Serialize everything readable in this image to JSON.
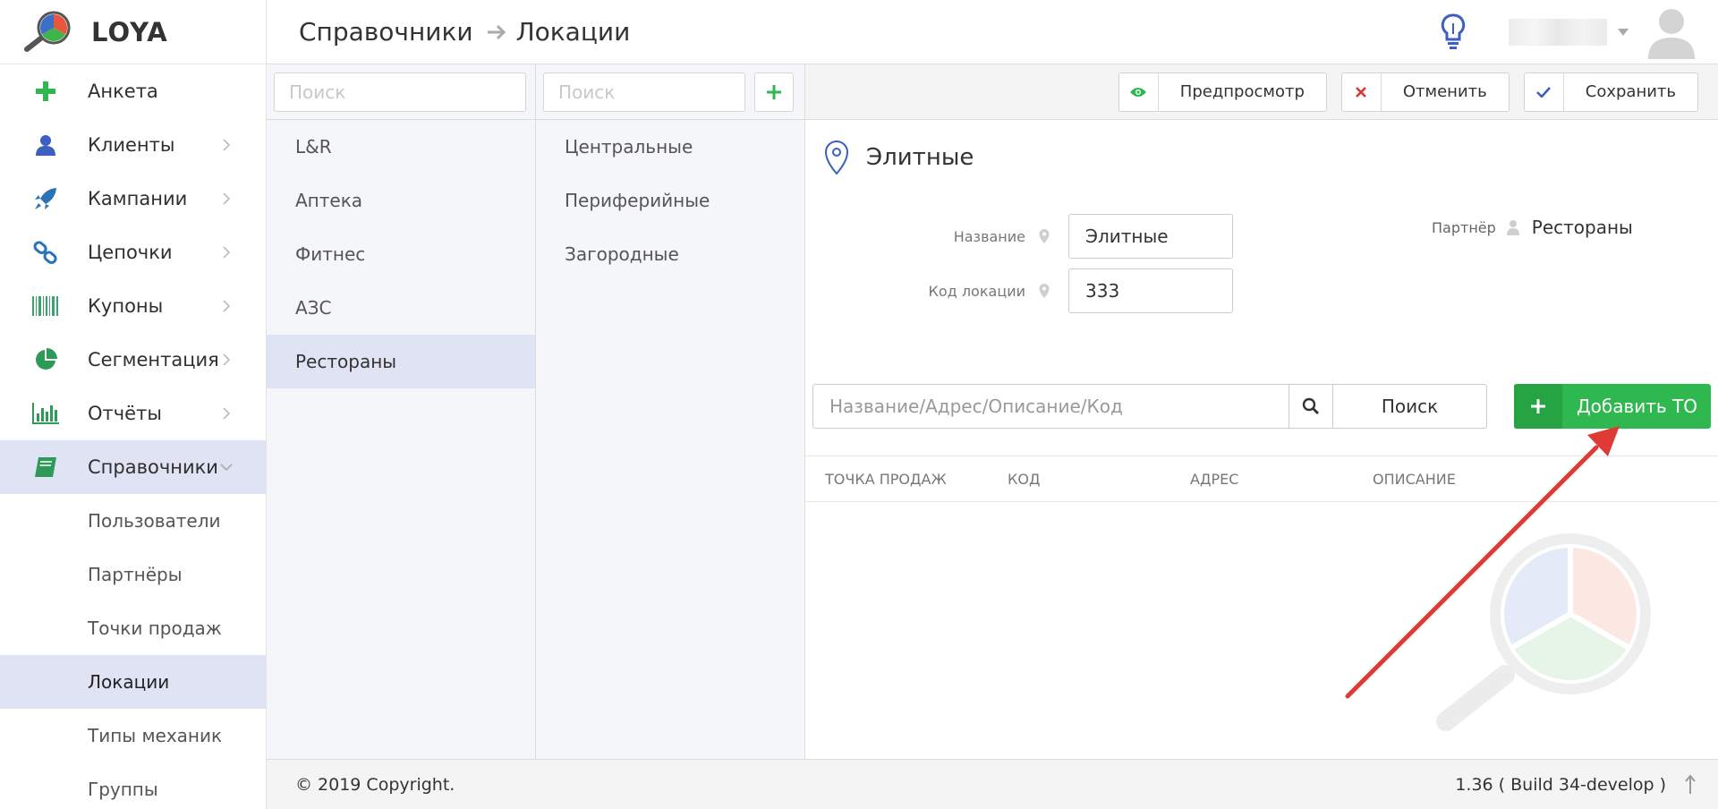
{
  "brand": {
    "name": "LOYA"
  },
  "header": {
    "breadcrumb": [
      "Справочники",
      "Локации"
    ]
  },
  "sidebar": {
    "items": [
      {
        "label": "Анкета",
        "icon": "plus-icon"
      },
      {
        "label": "Клиенты",
        "icon": "user-icon"
      },
      {
        "label": "Кампании",
        "icon": "rocket-icon"
      },
      {
        "label": "Цепочки",
        "icon": "link-icon"
      },
      {
        "label": "Купоны",
        "icon": "barcode-icon"
      },
      {
        "label": "Сегментация",
        "icon": "pie-icon"
      },
      {
        "label": "Отчёты",
        "icon": "bar-chart-icon"
      },
      {
        "label": "Справочники",
        "icon": "book-icon"
      }
    ],
    "subitems": [
      "Пользователи",
      "Партнёры",
      "Точки продаж",
      "Локации",
      "Типы механик",
      "Группы"
    ]
  },
  "partners": {
    "search_placeholder": "Поиск",
    "items": [
      "L&R",
      "Аптека",
      "Фитнес",
      "АЗС",
      "Рестораны"
    ]
  },
  "locations": {
    "search_placeholder": "Поиск",
    "items": [
      "Центральные",
      "Периферийные",
      "Загородные"
    ]
  },
  "toolbar": {
    "preview_label": "Предпросмотр",
    "cancel_label": "Отменить",
    "save_label": "Сохранить"
  },
  "detail": {
    "title": "Элитные",
    "name_label": "Название",
    "name_value": "Элитные",
    "code_label": "Код локации",
    "code_value": "333",
    "partner_label": "Партнёр",
    "partner_value": "Рестораны",
    "search_placeholder": "Название/Адрес/Описание/Код",
    "search_button": "Поиск",
    "add_button": "Добавить ТО",
    "columns": [
      "ТОЧКА ПРОДАЖ",
      "КОД",
      "АДРЕС",
      "ОПИСАНИЕ"
    ]
  },
  "footer": {
    "copyright": "© 2019 Copyright.",
    "version": "1.36 ( Build 34-develop )"
  },
  "colors": {
    "accent_green": "#2eb84f",
    "active_bg": "#dfe3f3",
    "arrow_red": "#e03a36"
  }
}
